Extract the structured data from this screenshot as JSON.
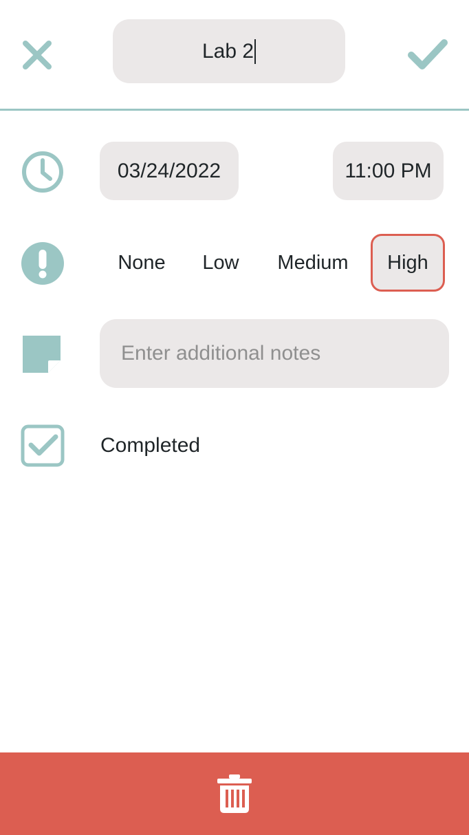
{
  "header": {
    "title_value": "Lab 2",
    "cancel_icon": "close-icon",
    "confirm_icon": "checkmark-icon"
  },
  "due": {
    "icon": "clock-icon",
    "date": "03/24/2022",
    "time": "11:00 PM"
  },
  "priority": {
    "icon": "exclamation-icon",
    "options": [
      "None",
      "Low",
      "Medium",
      "High"
    ],
    "selected": "High"
  },
  "notes": {
    "icon": "sticky-note-icon",
    "placeholder": "Enter additional notes",
    "value": ""
  },
  "completed": {
    "icon": "checkbox-checked-icon",
    "label": "Completed",
    "checked": true
  },
  "footer": {
    "delete_icon": "trash-icon"
  },
  "colors": {
    "accent": "#9bc6c4",
    "danger": "#dc5e51",
    "field_bg": "#ebe8e8",
    "text": "#1f2528",
    "placeholder": "#8f8f8f"
  }
}
